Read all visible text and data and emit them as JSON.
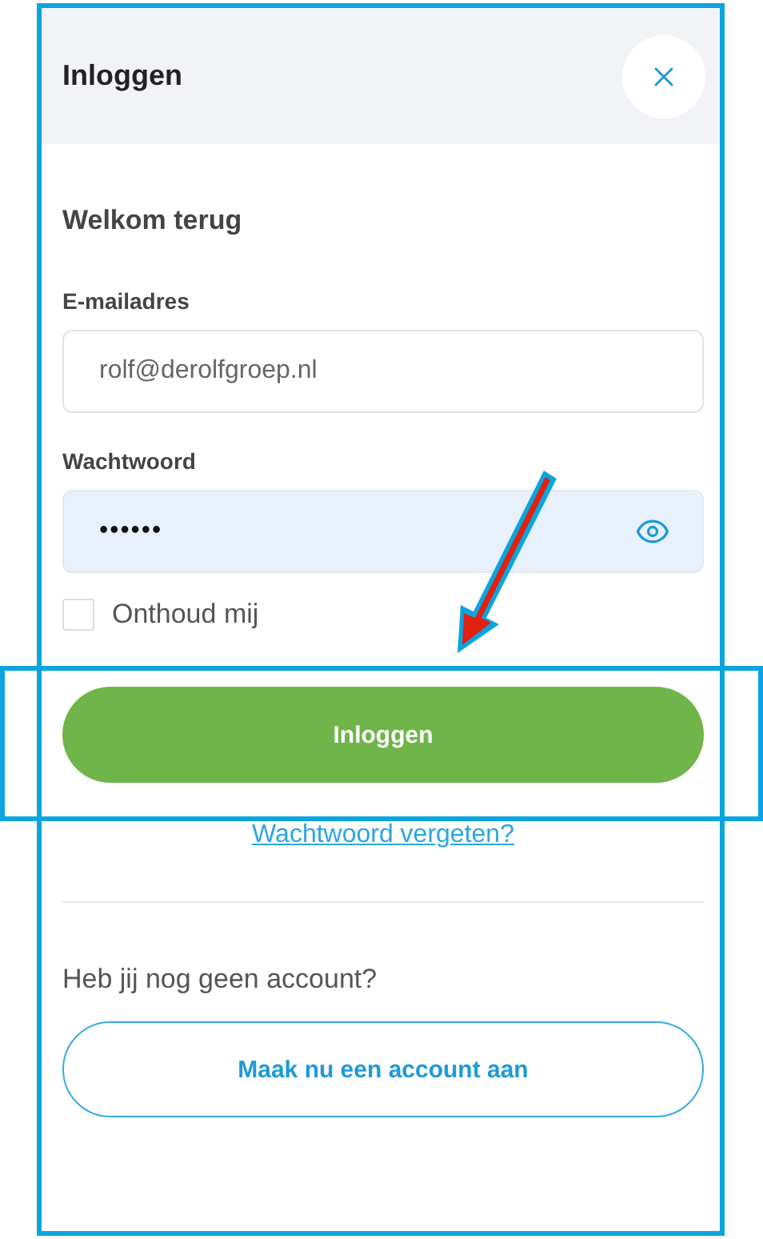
{
  "dialog": {
    "title": "Inloggen",
    "close_button": true
  },
  "greeting": "Welkom terug",
  "email": {
    "label": "E-mailadres",
    "value": "rolf@derolfgroep.nl"
  },
  "password": {
    "label": "Wachtwoord",
    "value": "••••••",
    "focused": true
  },
  "remember": {
    "label": "Onthoud mij",
    "checked": false
  },
  "login_button": "Inloggen",
  "forgot_link": "Wachtwoord vergeten?",
  "signup": {
    "prompt": "Heb jij nog geen account?",
    "button": "Maak nu een account aan"
  }
}
